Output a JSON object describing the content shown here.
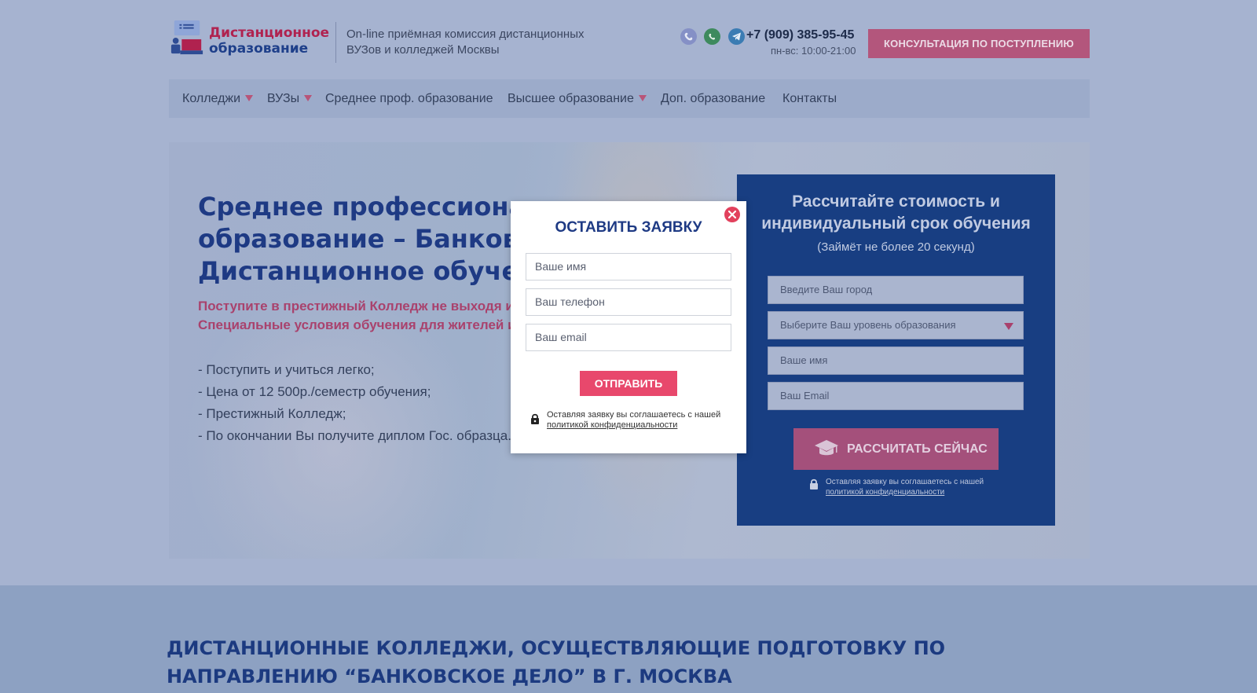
{
  "header": {
    "logo_line1": "Дистанционное",
    "logo_line2": "образование",
    "tagline": "On-line приёмная комиссия дистанционных ВУЗов и колледжей Москвы",
    "phone": "+7 (909) 385-95-45",
    "hours": "пн-вс: 10:00-21:00",
    "consult_button": "Консультация по поступлению",
    "icons": [
      "viber-icon",
      "whatsapp-icon",
      "telegram-icon"
    ]
  },
  "nav": {
    "items": [
      {
        "label": "Колледжи",
        "dropdown": true
      },
      {
        "label": "ВУЗы",
        "dropdown": true
      },
      {
        "label": "Среднее проф. образование",
        "dropdown": false
      },
      {
        "label": "Высшее образование",
        "dropdown": true
      },
      {
        "label": "Доп. образование",
        "dropdown": false
      },
      {
        "label": "Контакты",
        "dropdown": false
      }
    ]
  },
  "hero": {
    "title_line1": "Среднее профессиона...",
    "title_line2": "образование – Банкове...",
    "title_line3": "Дистанционное обучен...",
    "subtitle_line1": "Поступите в престижный Колледж не выходя из...",
    "subtitle_line2": "Специальные условия обучения для жителей из...",
    "list": [
      "- Поступить и учиться легко;",
      "- Цена от 12 500р./семестр обучения;",
      "- Престижный Колледж;",
      "- По окончании Вы получите диплом Гос. образца..."
    ]
  },
  "calc": {
    "title": "Рассчитайте стоимость и индивидуальный срок обучения",
    "note": "(Займёт не более 20 секунд)",
    "city_placeholder": "Введите Ваш город",
    "level_placeholder": "Выберите Ваш уровень образования",
    "name_placeholder": "Ваше имя",
    "email_placeholder": "Ваш Email",
    "button": "Рассчитать сейчас",
    "privacy_text": "Оставляя заявку вы соглашаетесь с нашей",
    "privacy_link": "политикой конфиденциальности"
  },
  "modal": {
    "title": "Оставить заявку",
    "name_placeholder": "Ваше имя",
    "phone_placeholder": "Ваш телефон",
    "email_placeholder": "Ваш email",
    "submit": "Отправить",
    "privacy_text": "Оставляя заявку вы соглашаетесь с нашей",
    "privacy_link": "политикой конфиденциальности"
  },
  "section": {
    "title": "Дистанционные колледжи, осуществляющие подготовку по направлению “банковское дело” в г. Москва"
  },
  "colors": {
    "brand_blue": "#1e3a84",
    "accent_pink": "#e8486c",
    "overlay_bg": "#a6b3d0"
  }
}
